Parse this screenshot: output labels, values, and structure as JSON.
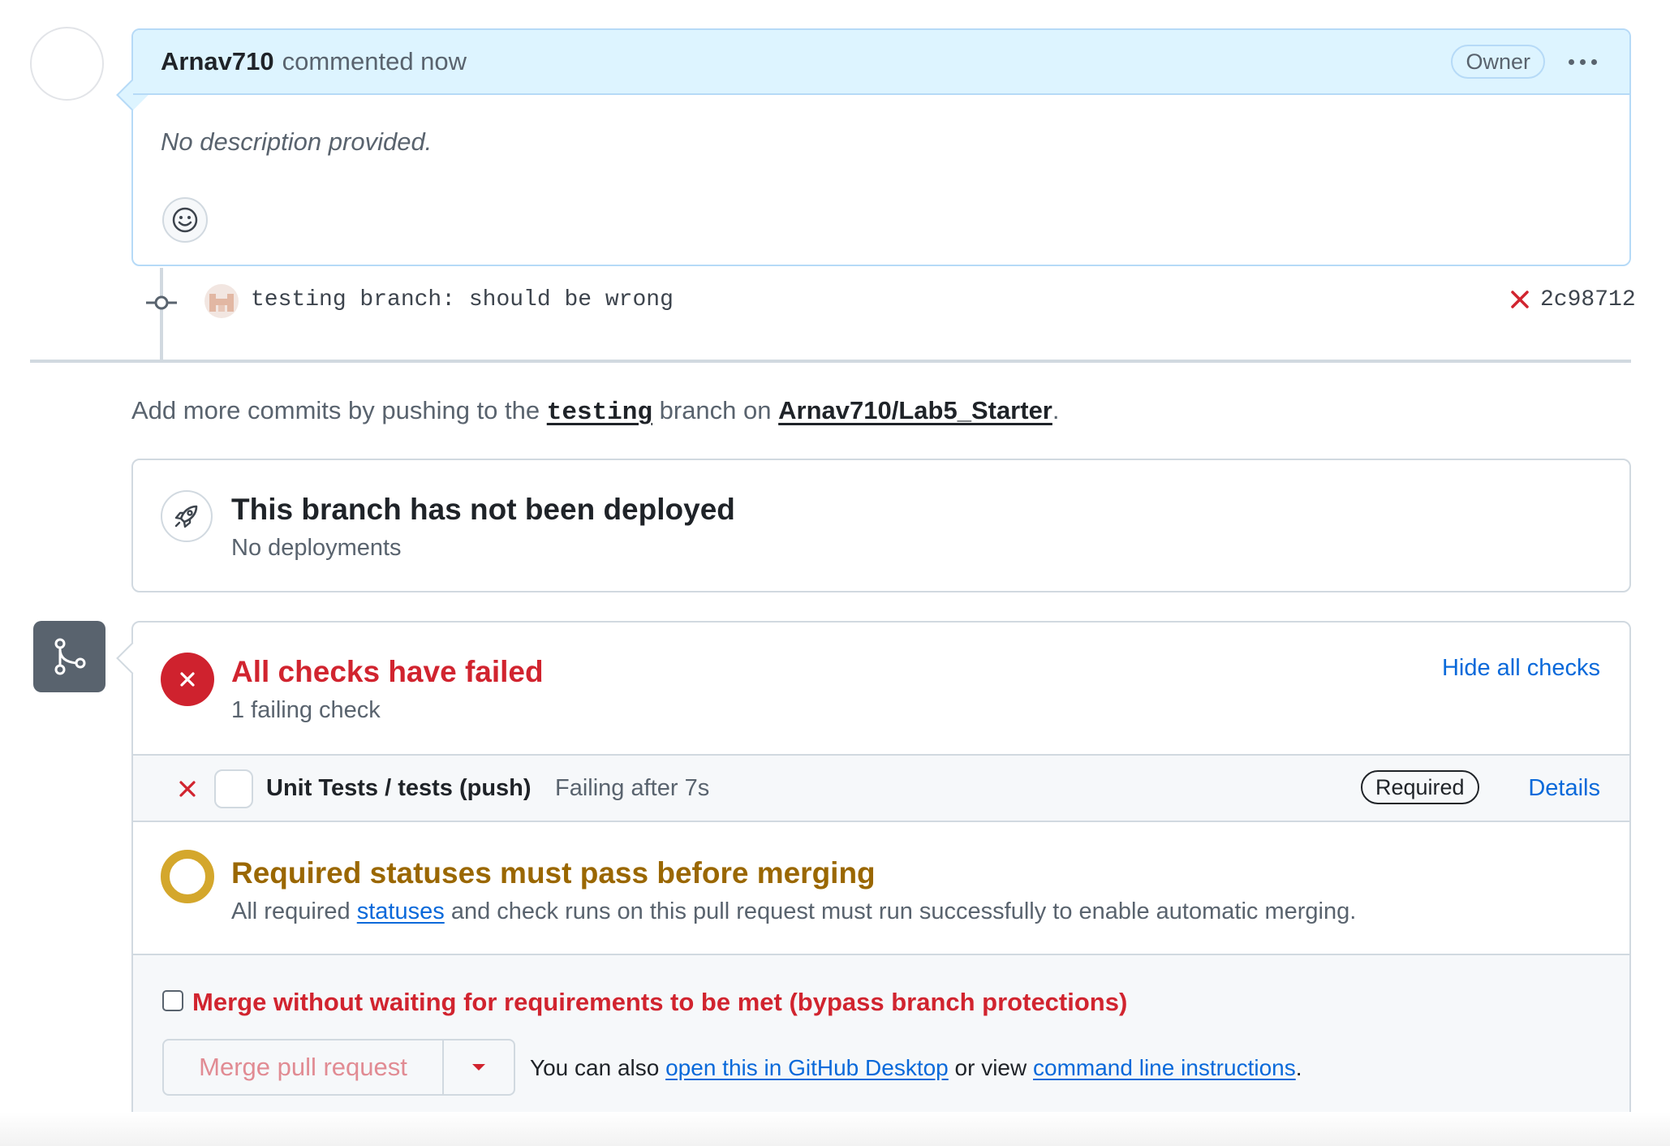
{
  "comment": {
    "author": "Arnav710",
    "action": "commented now",
    "role_badge": "Owner",
    "body": "No description provided."
  },
  "commit": {
    "message": "testing branch: should be wrong",
    "sha": "2c98712",
    "status": "failed"
  },
  "push_hint": {
    "prefix": "Add more commits by pushing to the",
    "branch": "testing",
    "middle": "branch on",
    "repo": "Arnav710/Lab5_Starter",
    "suffix": "."
  },
  "deployment": {
    "title": "This branch has not been deployed",
    "subtitle": "No deployments"
  },
  "checks": {
    "title": "All checks have failed",
    "subtitle": "1 failing check",
    "toggle_label": "Hide all checks",
    "items": [
      {
        "name": "Unit Tests / tests (push)",
        "status": "Failing after 7s",
        "badge": "Required",
        "link": "Details"
      }
    ]
  },
  "requirements": {
    "title": "Required statuses must pass before merging",
    "text_prefix": "All required",
    "link": "statuses",
    "text_suffix": "and check runs on this pull request must run successfully to enable automatic merging."
  },
  "merge": {
    "bypass_label": "Merge without waiting for requirements to be met (bypass branch protections)",
    "bypass_checked": false,
    "button_label": "Merge pull request",
    "hint_prefix": "You can also",
    "desktop_link": "open this in GitHub Desktop",
    "hint_middle": "or view",
    "cli_link": "command line instructions",
    "hint_suffix": "."
  },
  "colors": {
    "danger": "#d1242f",
    "attention": "#9a6700",
    "link": "#0969da",
    "comment_header_bg": "#ddf4ff"
  }
}
